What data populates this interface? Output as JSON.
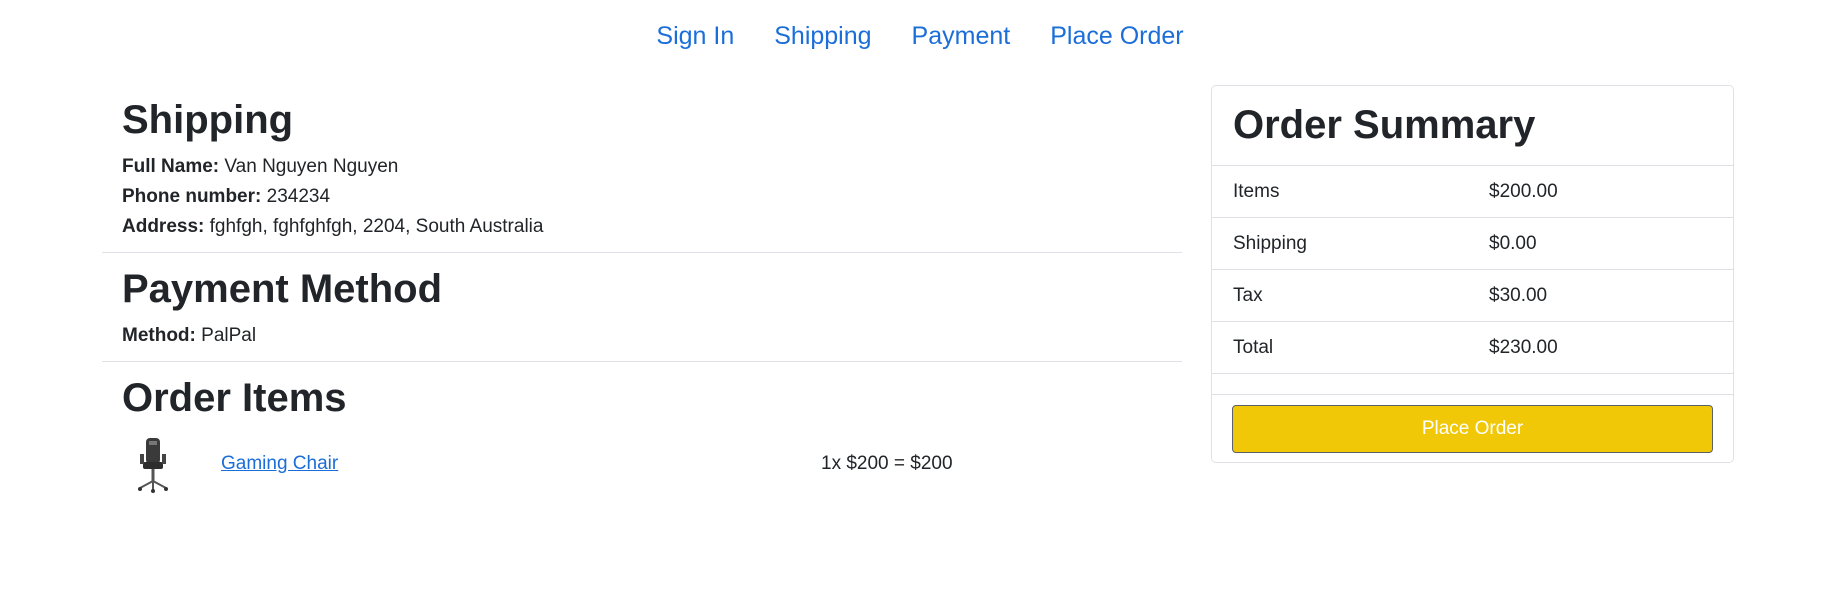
{
  "steps": [
    "Sign In",
    "Shipping",
    "Payment",
    "Place Order"
  ],
  "shipping": {
    "title": "Shipping",
    "full_name_label": "Full Name:",
    "full_name": "Van Nguyen Nguyen",
    "phone_label": "Phone number:",
    "phone": "234234",
    "address_label": "Address:",
    "address": "fghfgh, fghfghfgh, 2204, South Australia"
  },
  "payment": {
    "title": "Payment Method",
    "method_label": "Method:",
    "method": "PalPal"
  },
  "order_items": {
    "title": "Order Items",
    "items": [
      {
        "name": "Gaming Chair",
        "price_text": "1x $200 = $200",
        "icon": "gaming-chair-image"
      }
    ]
  },
  "summary": {
    "title": "Order Summary",
    "rows": [
      {
        "label": "Items",
        "value": "$200.00"
      },
      {
        "label": "Shipping",
        "value": "$0.00"
      },
      {
        "label": "Tax",
        "value": "$30.00"
      },
      {
        "label": "Total",
        "value": "$230.00"
      }
    ],
    "button_label": "Place Order"
  },
  "colors": {
    "link": "#1b6ed8",
    "button": "#f0c808",
    "border": "#dee2e6"
  }
}
